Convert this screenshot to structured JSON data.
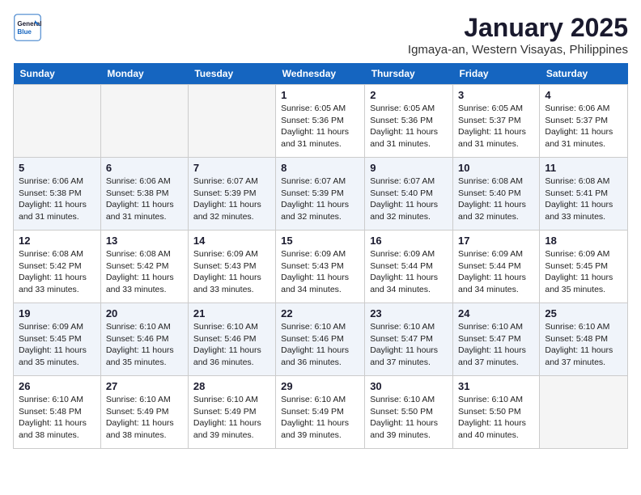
{
  "header": {
    "logo_line1": "General",
    "logo_line2": "Blue",
    "month": "January 2025",
    "location": "Igmaya-an, Western Visayas, Philippines"
  },
  "days_of_week": [
    "Sunday",
    "Monday",
    "Tuesday",
    "Wednesday",
    "Thursday",
    "Friday",
    "Saturday"
  ],
  "weeks": [
    {
      "cells": [
        {
          "day": null,
          "content": null
        },
        {
          "day": null,
          "content": null
        },
        {
          "day": null,
          "content": null
        },
        {
          "day": "1",
          "content": "Sunrise: 6:05 AM\nSunset: 5:36 PM\nDaylight: 11 hours\nand 31 minutes."
        },
        {
          "day": "2",
          "content": "Sunrise: 6:05 AM\nSunset: 5:36 PM\nDaylight: 11 hours\nand 31 minutes."
        },
        {
          "day": "3",
          "content": "Sunrise: 6:05 AM\nSunset: 5:37 PM\nDaylight: 11 hours\nand 31 minutes."
        },
        {
          "day": "4",
          "content": "Sunrise: 6:06 AM\nSunset: 5:37 PM\nDaylight: 11 hours\nand 31 minutes."
        }
      ]
    },
    {
      "cells": [
        {
          "day": "5",
          "content": "Sunrise: 6:06 AM\nSunset: 5:38 PM\nDaylight: 11 hours\nand 31 minutes."
        },
        {
          "day": "6",
          "content": "Sunrise: 6:06 AM\nSunset: 5:38 PM\nDaylight: 11 hours\nand 31 minutes."
        },
        {
          "day": "7",
          "content": "Sunrise: 6:07 AM\nSunset: 5:39 PM\nDaylight: 11 hours\nand 32 minutes."
        },
        {
          "day": "8",
          "content": "Sunrise: 6:07 AM\nSunset: 5:39 PM\nDaylight: 11 hours\nand 32 minutes."
        },
        {
          "day": "9",
          "content": "Sunrise: 6:07 AM\nSunset: 5:40 PM\nDaylight: 11 hours\nand 32 minutes."
        },
        {
          "day": "10",
          "content": "Sunrise: 6:08 AM\nSunset: 5:40 PM\nDaylight: 11 hours\nand 32 minutes."
        },
        {
          "day": "11",
          "content": "Sunrise: 6:08 AM\nSunset: 5:41 PM\nDaylight: 11 hours\nand 33 minutes."
        }
      ]
    },
    {
      "cells": [
        {
          "day": "12",
          "content": "Sunrise: 6:08 AM\nSunset: 5:42 PM\nDaylight: 11 hours\nand 33 minutes."
        },
        {
          "day": "13",
          "content": "Sunrise: 6:08 AM\nSunset: 5:42 PM\nDaylight: 11 hours\nand 33 minutes."
        },
        {
          "day": "14",
          "content": "Sunrise: 6:09 AM\nSunset: 5:43 PM\nDaylight: 11 hours\nand 33 minutes."
        },
        {
          "day": "15",
          "content": "Sunrise: 6:09 AM\nSunset: 5:43 PM\nDaylight: 11 hours\nand 34 minutes."
        },
        {
          "day": "16",
          "content": "Sunrise: 6:09 AM\nSunset: 5:44 PM\nDaylight: 11 hours\nand 34 minutes."
        },
        {
          "day": "17",
          "content": "Sunrise: 6:09 AM\nSunset: 5:44 PM\nDaylight: 11 hours\nand 34 minutes."
        },
        {
          "day": "18",
          "content": "Sunrise: 6:09 AM\nSunset: 5:45 PM\nDaylight: 11 hours\nand 35 minutes."
        }
      ]
    },
    {
      "cells": [
        {
          "day": "19",
          "content": "Sunrise: 6:09 AM\nSunset: 5:45 PM\nDaylight: 11 hours\nand 35 minutes."
        },
        {
          "day": "20",
          "content": "Sunrise: 6:10 AM\nSunset: 5:46 PM\nDaylight: 11 hours\nand 35 minutes."
        },
        {
          "day": "21",
          "content": "Sunrise: 6:10 AM\nSunset: 5:46 PM\nDaylight: 11 hours\nand 36 minutes."
        },
        {
          "day": "22",
          "content": "Sunrise: 6:10 AM\nSunset: 5:46 PM\nDaylight: 11 hours\nand 36 minutes."
        },
        {
          "day": "23",
          "content": "Sunrise: 6:10 AM\nSunset: 5:47 PM\nDaylight: 11 hours\nand 37 minutes."
        },
        {
          "day": "24",
          "content": "Sunrise: 6:10 AM\nSunset: 5:47 PM\nDaylight: 11 hours\nand 37 minutes."
        },
        {
          "day": "25",
          "content": "Sunrise: 6:10 AM\nSunset: 5:48 PM\nDaylight: 11 hours\nand 37 minutes."
        }
      ]
    },
    {
      "cells": [
        {
          "day": "26",
          "content": "Sunrise: 6:10 AM\nSunset: 5:48 PM\nDaylight: 11 hours\nand 38 minutes."
        },
        {
          "day": "27",
          "content": "Sunrise: 6:10 AM\nSunset: 5:49 PM\nDaylight: 11 hours\nand 38 minutes."
        },
        {
          "day": "28",
          "content": "Sunrise: 6:10 AM\nSunset: 5:49 PM\nDaylight: 11 hours\nand 39 minutes."
        },
        {
          "day": "29",
          "content": "Sunrise: 6:10 AM\nSunset: 5:49 PM\nDaylight: 11 hours\nand 39 minutes."
        },
        {
          "day": "30",
          "content": "Sunrise: 6:10 AM\nSunset: 5:50 PM\nDaylight: 11 hours\nand 39 minutes."
        },
        {
          "day": "31",
          "content": "Sunrise: 6:10 AM\nSunset: 5:50 PM\nDaylight: 11 hours\nand 40 minutes."
        },
        {
          "day": null,
          "content": null
        }
      ]
    }
  ]
}
